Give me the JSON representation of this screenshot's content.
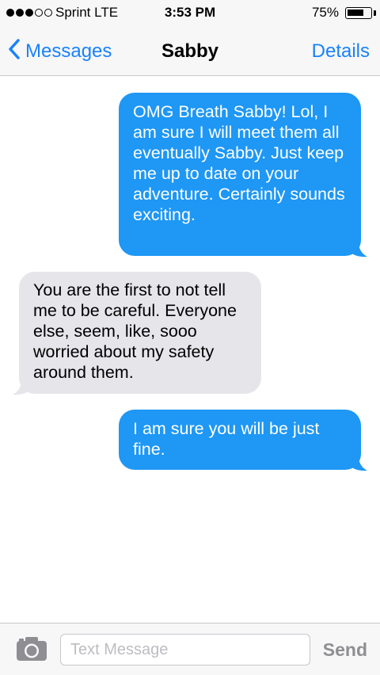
{
  "status_bar": {
    "carrier": "Sprint  LTE",
    "time": "3:53 PM",
    "battery_percent": "75%",
    "battery_level": 0.75,
    "signal_bars_filled": 3,
    "signal_bars_total": 5
  },
  "nav": {
    "back_label": "Messages",
    "title": "Sabby",
    "details_label": "Details",
    "back_icon": "chevron-left-icon"
  },
  "messages": [
    {
      "direction": "outgoing",
      "text": "OMG Breath Sabby! Lol, I am sure I will meet them all eventually Sabby. Just keep me up to date on your adventure. Certainly sounds exciting."
    },
    {
      "direction": "incoming",
      "text": "You are the first to not tell me to be careful. Everyone else, seem, like, sooo worried about my safety around them."
    },
    {
      "direction": "outgoing",
      "text": "I am sure you will be just fine."
    }
  ],
  "input_bar": {
    "camera_icon": "camera-icon",
    "placeholder": "Text Message",
    "send_label": "Send"
  },
  "colors": {
    "accent": "#1a82fb",
    "outgoing_bubble": "#1e97f5",
    "incoming_bubble": "#e5e5ea",
    "send_disabled": "#8e8e93"
  }
}
